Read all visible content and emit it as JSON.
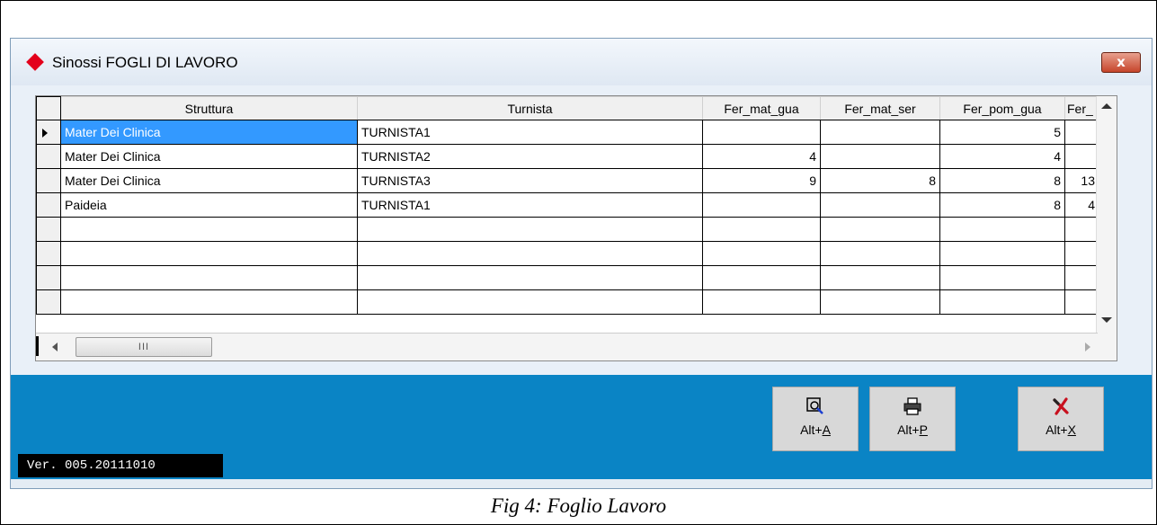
{
  "window": {
    "title": "Sinossi FOGLI DI LAVORO",
    "close_label": "x"
  },
  "grid": {
    "columns": [
      "Struttura",
      "Turnista",
      "Fer_mat_gua",
      "Fer_mat_ser",
      "Fer_pom_gua",
      "Fer_"
    ],
    "rows": [
      {
        "struttura": "Mater Dei Clinica",
        "turnista": "TURNISTA1",
        "fer_mat_gua": "",
        "fer_mat_ser": "",
        "fer_pom_gua": "5",
        "fer_extra": ""
      },
      {
        "struttura": "Mater Dei Clinica",
        "turnista": "TURNISTA2",
        "fer_mat_gua": "4",
        "fer_mat_ser": "",
        "fer_pom_gua": "4",
        "fer_extra": ""
      },
      {
        "struttura": "Mater Dei Clinica",
        "turnista": "TURNISTA3",
        "fer_mat_gua": "9",
        "fer_mat_ser": "8",
        "fer_pom_gua": "8",
        "fer_extra": "13"
      },
      {
        "struttura": "Paideia",
        "turnista": "TURNISTA1",
        "fer_mat_gua": "",
        "fer_mat_ser": "",
        "fer_pom_gua": "8",
        "fer_extra": "4"
      }
    ],
    "scroll_thumb_glyph": "III"
  },
  "toolbar": {
    "search": {
      "prefix": "Alt+",
      "key": "A",
      "icon": "search-icon"
    },
    "print": {
      "prefix": "Alt+",
      "key": "P",
      "icon": "printer-icon"
    },
    "exit": {
      "prefix": "Alt+",
      "key": "X",
      "icon": "close-x-icon"
    }
  },
  "version": "Ver. 005.20111010",
  "caption": "Fig 4: Foglio Lavoro",
  "colors": {
    "accent": "#0a84c5",
    "selection": "#3399ff",
    "title_icon": "#e3001b"
  }
}
